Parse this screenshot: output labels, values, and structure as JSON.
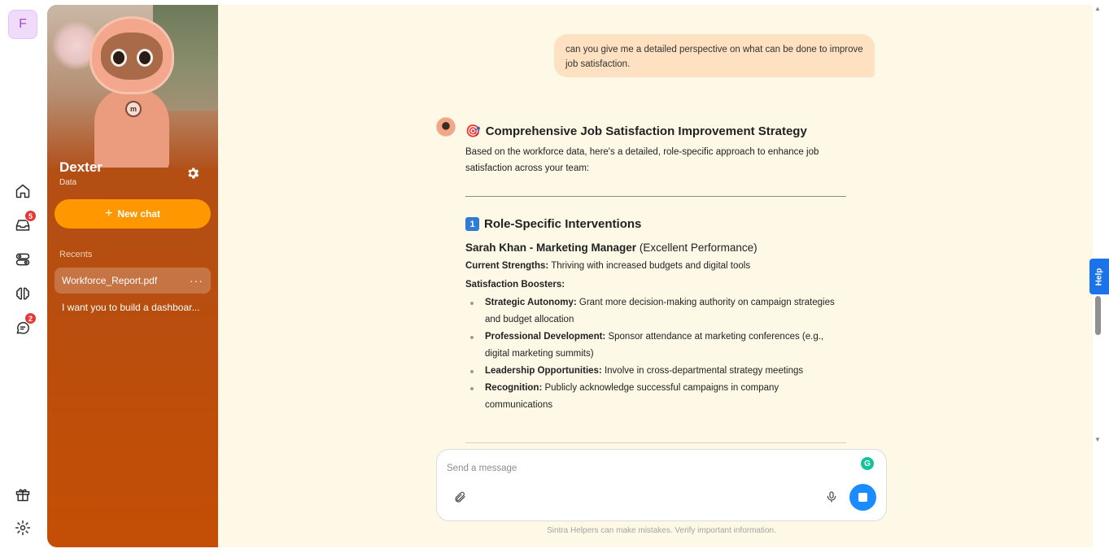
{
  "rail": {
    "avatar_letter": "F",
    "inbox_badge": "5",
    "chat_badge": "2"
  },
  "sidebar": {
    "agent_name": "Dexter",
    "agent_role": "Data",
    "new_chat_label": "New chat",
    "recents_label": "Recents",
    "recents": [
      {
        "label": "Workforce_Report.pdf",
        "active": true
      },
      {
        "label": "I want you to build a dashboar...",
        "active": false
      }
    ]
  },
  "conversation": {
    "user_message": "can you give me a detailed perspective on what can be done to improve job satisfaction.",
    "answer": {
      "title_emoji": "🎯",
      "title": "Comprehensive Job Satisfaction Improvement Strategy",
      "intro": "Based on the workforce data, here's a detailed, role-specific approach to enhance job satisfaction across your team:",
      "section_number": "1",
      "section_title": "Role-Specific Interventions",
      "person_name": "Sarah Khan - Marketing Manager",
      "person_note": "(Excellent Performance)",
      "strengths_label": "Current Strengths:",
      "strengths_text": "Thriving with increased budgets and digital tools",
      "boosters_title": "Satisfaction Boosters:",
      "boosters": [
        {
          "label": "Strategic Autonomy:",
          "text": "Grant more decision-making authority on campaign strategies and budget allocation"
        },
        {
          "label": "Professional Development:",
          "text": "Sponsor attendance at marketing conferences (e.g., digital marketing summits)"
        },
        {
          "label": "Leadership Opportunities:",
          "text": "Involve in cross-departmental strategy meetings"
        },
        {
          "label": "Recognition:",
          "text": "Publicly acknowledge successful campaigns in company communications"
        }
      ]
    }
  },
  "composer": {
    "placeholder": "Send a message",
    "grammarly_letter": "G",
    "disclaimer": "Sintra Helpers can make mistakes. Verify important information."
  },
  "help_tab": "Help",
  "colors": {
    "sidebar_top": "#b2521d",
    "sidebar_bottom": "#c44e05",
    "new_chat": "#ff9800",
    "main_bg": "#fef9e7",
    "user_bubble": "#fde1c1",
    "send_button": "#1a8cff",
    "badge": "#e53935",
    "help_tab": "#1a73e8"
  }
}
